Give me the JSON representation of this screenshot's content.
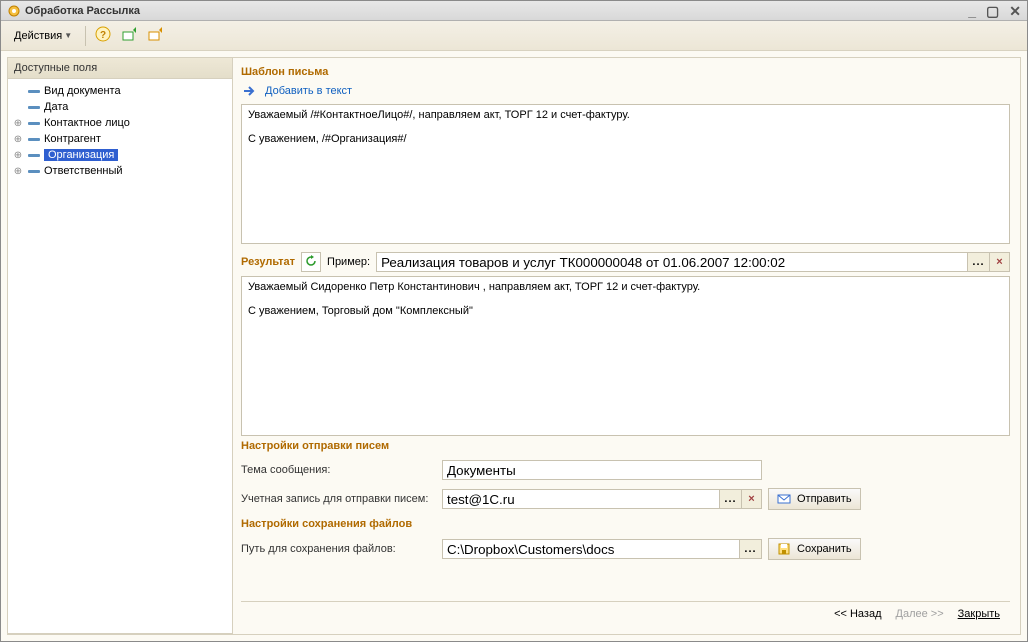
{
  "title": "Обработка  Рассылка",
  "toolbar": {
    "actions_label": "Действия"
  },
  "left": {
    "header": "Доступные поля",
    "items": [
      {
        "label": "Вид документа",
        "expandable": false
      },
      {
        "label": "Дата",
        "expandable": false
      },
      {
        "label": "Контактное лицо",
        "expandable": true
      },
      {
        "label": "Контрагент",
        "expandable": true
      },
      {
        "label": "Организация",
        "expandable": true,
        "selected": true
      },
      {
        "label": "Ответственный",
        "expandable": true
      }
    ]
  },
  "template": {
    "title": "Шаблон письма",
    "add_label": "Добавить в текст",
    "body": "Уважаемый /#КонтактноеЛицо#/, направляем акт, ТОРГ 12 и счет-фактуру.\n\nС уважением, /#Организация#/"
  },
  "result": {
    "title": "Результат",
    "example_label": "Пример:",
    "example_value": "Реализация товаров и услуг ТК000000048 от 01.06.2007 12:00:02",
    "body": "Уважаемый Сидоренко Петр Константинович , направляем акт, ТОРГ 12 и счет-фактуру.\n\nС уважением, Торговый дом \"Комплексный\""
  },
  "send_settings": {
    "title": "Настройки отправки писем",
    "subject_label": "Тема сообщения:",
    "subject_value": "Документы",
    "account_label": "Учетная запись для отправки писем:",
    "account_value": "test@1C.ru",
    "send_button": "Отправить"
  },
  "save_settings": {
    "title": "Настройки сохранения файлов",
    "path_label": "Путь для сохранения файлов:",
    "path_value": "C:\\Dropbox\\Customers\\docs",
    "save_button": "Сохранить"
  },
  "bottom": {
    "back": "<< Назад",
    "next": "Далее >>",
    "close": "Закрыть"
  }
}
